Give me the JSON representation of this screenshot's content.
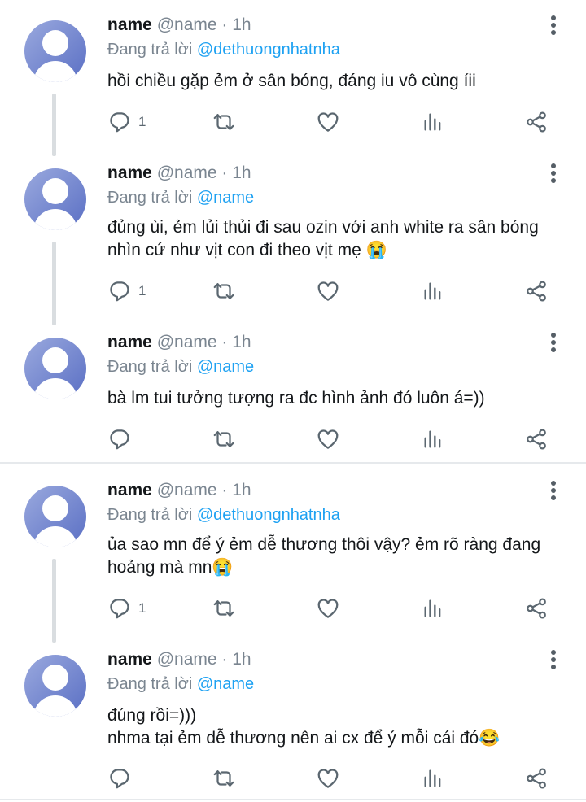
{
  "tweets": [
    {
      "name": "name",
      "handle": "@name",
      "dot": "·",
      "time": "1h",
      "reply_prefix": "Đang trả lời",
      "reply_to": "@dethuongnhatnha",
      "text_lines": [
        "hồi chiều gặp ẻm ở sân bóng, đáng iu vô cùng íii"
      ],
      "reply_count": "1"
    },
    {
      "name": "name",
      "handle": "@name",
      "dot": "·",
      "time": "1h",
      "reply_prefix": "Đang trả lời",
      "reply_to": "@name",
      "text_lines": [
        "đủng ùi, ẻm lủi thủi đi sau ozin với anh white ra sân bóng",
        "nhìn cứ như vịt con đi theo vịt mẹ 😭"
      ],
      "reply_count": "1"
    },
    {
      "name": "name",
      "handle": "@name",
      "dot": "·",
      "time": "1h",
      "reply_prefix": "Đang trả lời",
      "reply_to": "@name",
      "text_lines": [
        "bà lm tui tưởng tượng ra đc hình ảnh đó luôn á=))"
      ],
      "reply_count": ""
    },
    {
      "name": "name",
      "handle": "@name",
      "dot": "·",
      "time": "1h",
      "reply_prefix": "Đang trả lời",
      "reply_to": "@dethuongnhatnha",
      "text_lines": [
        "ủa sao mn để ý ẻm dễ thương thôi vậy? ẻm rõ ràng đang",
        "hoảng mà mn😭"
      ],
      "reply_count": "1"
    },
    {
      "name": "name",
      "handle": "@name",
      "dot": "·",
      "time": "1h",
      "reply_prefix": "Đang trả lời",
      "reply_to": "@name",
      "text_lines": [
        "đúng rồi=)))",
        "nhma tại ẻm dễ thương nên ai cx để ý mỗi cái đó😂"
      ],
      "reply_count": ""
    }
  ],
  "icons": {
    "reply": "reply-icon",
    "retweet": "retweet-icon",
    "like": "heart-icon",
    "analytics": "analytics-icon",
    "share": "share-icon",
    "more": "more-vertical-icon"
  },
  "colors": {
    "mention": "#1da1f2",
    "secondary_text": "#7a8590",
    "icon": "#5b6770",
    "avatar": "#6f80cf"
  }
}
